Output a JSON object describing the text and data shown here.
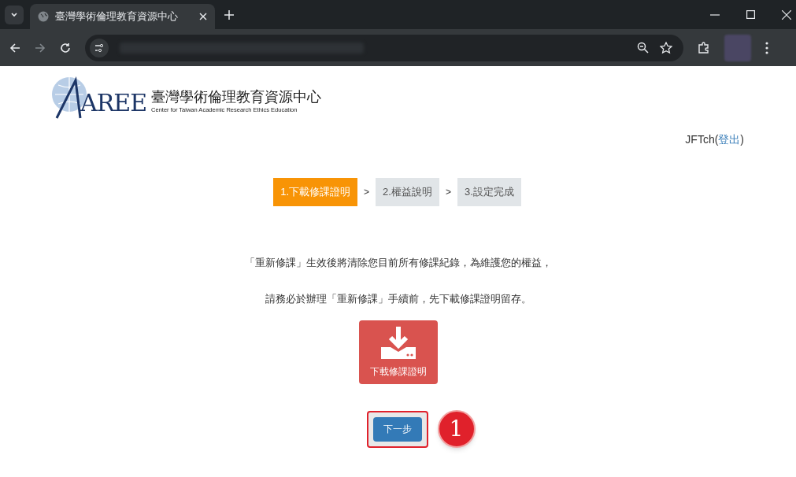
{
  "browser": {
    "tab_title": "臺灣學術倫理教育資源中心"
  },
  "logo": {
    "mark": "AREE",
    "title": "臺灣學術倫理教育資源中心",
    "subtitle": "Center for Taiwan Academic Research Ethics Education"
  },
  "user": {
    "name": "JFTch(",
    "logout": "登出",
    "close": ")"
  },
  "steps": [
    {
      "label": "1.下載修課證明",
      "selected": true
    },
    {
      "label": "2.權益說明",
      "selected": false
    },
    {
      "label": "3.設定完成",
      "selected": false
    }
  ],
  "step_separator": ">",
  "notice": [
    "「重新修課」生效後將清除您目前所有修課紀錄，為維護您的權益，",
    "請務必於辦理「重新修課」手續前，先下載修課證明留存。"
  ],
  "download_button": {
    "label": "下載修課證明"
  },
  "next_button": {
    "label": "下一步",
    "highlighted": true
  },
  "annotation": {
    "number": "1"
  }
}
